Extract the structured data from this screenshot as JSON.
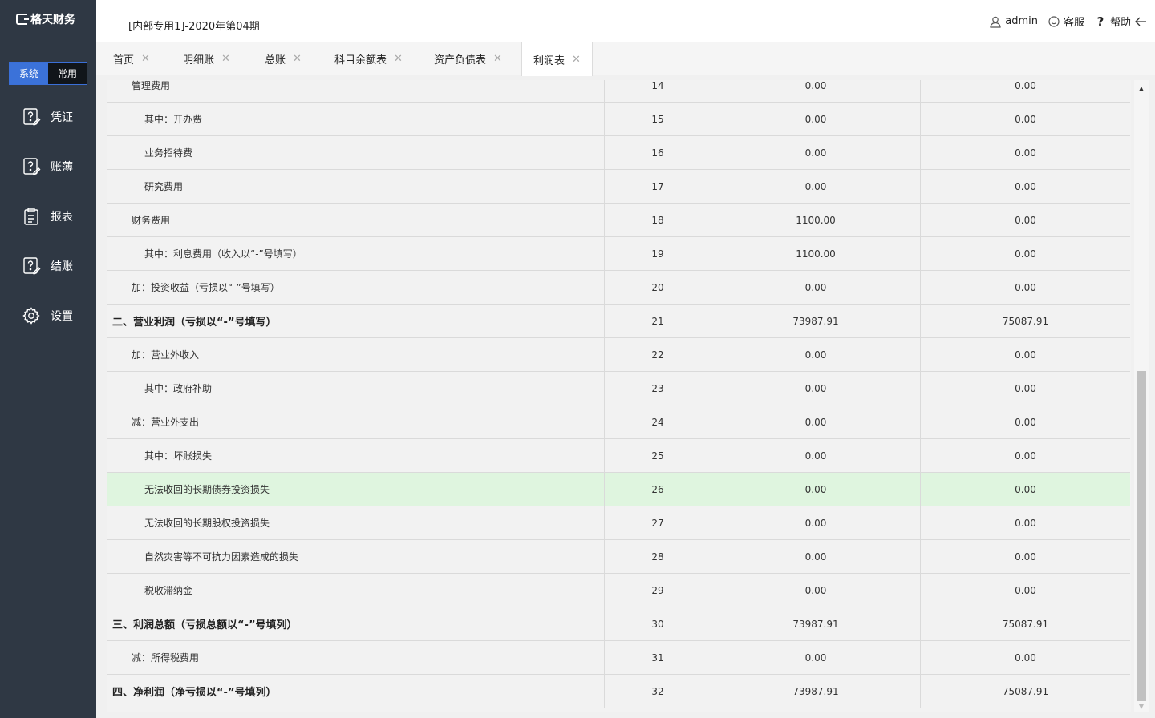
{
  "brand": "格天财务",
  "sidebar": {
    "mode_system": "系统",
    "mode_common": "常用",
    "items": [
      {
        "label": "凭证",
        "icon": "voucher-icon"
      },
      {
        "label": "账薄",
        "icon": "ledger-icon"
      },
      {
        "label": "报表",
        "icon": "report-icon"
      },
      {
        "label": "结账",
        "icon": "closing-icon"
      },
      {
        "label": "设置",
        "icon": "gear-icon"
      }
    ]
  },
  "header": {
    "period": "[内部专用1]-2020年第04期",
    "user": "admin",
    "service": "客服",
    "help": "帮助"
  },
  "tabs": [
    {
      "label": "首页",
      "active": false
    },
    {
      "label": "明细账",
      "active": false
    },
    {
      "label": "总账",
      "active": false
    },
    {
      "label": "科目余额表",
      "active": false
    },
    {
      "label": "资产负债表",
      "active": false
    },
    {
      "label": "利润表",
      "active": true
    }
  ],
  "table": {
    "rows": [
      {
        "name": "管理费用",
        "num": "14",
        "v1": "0.00",
        "v2": "0.00",
        "indent": 1
      },
      {
        "name": "其中：开办费",
        "num": "15",
        "v1": "0.00",
        "v2": "0.00",
        "indent": 2
      },
      {
        "name": "业务招待费",
        "num": "16",
        "v1": "0.00",
        "v2": "0.00",
        "indent": 2
      },
      {
        "name": "研究费用",
        "num": "17",
        "v1": "0.00",
        "v2": "0.00",
        "indent": 2
      },
      {
        "name": "财务费用",
        "num": "18",
        "v1": "1100.00",
        "v2": "0.00",
        "indent": 1
      },
      {
        "name": "其中：利息费用（收入以“-”号填写）",
        "num": "19",
        "v1": "1100.00",
        "v2": "0.00",
        "indent": 2
      },
      {
        "name": "加：投资收益（亏损以“-”号填写）",
        "num": "20",
        "v1": "0.00",
        "v2": "0.00",
        "indent": 1
      },
      {
        "name": "二、营业利润（亏损以“-”号填写）",
        "num": "21",
        "v1": "73987.91",
        "v2": "75087.91",
        "indent": 0,
        "bold": true
      },
      {
        "name": "加：营业外收入",
        "num": "22",
        "v1": "0.00",
        "v2": "0.00",
        "indent": 1
      },
      {
        "name": "其中：政府补助",
        "num": "23",
        "v1": "0.00",
        "v2": "0.00",
        "indent": 2
      },
      {
        "name": "减：营业外支出",
        "num": "24",
        "v1": "0.00",
        "v2": "0.00",
        "indent": 1
      },
      {
        "name": "其中：坏账损失",
        "num": "25",
        "v1": "0.00",
        "v2": "0.00",
        "indent": 2
      },
      {
        "name": "无法收回的长期债券投资损失",
        "num": "26",
        "v1": "0.00",
        "v2": "0.00",
        "indent": 2,
        "highlight": true
      },
      {
        "name": "无法收回的长期股权投资损失",
        "num": "27",
        "v1": "0.00",
        "v2": "0.00",
        "indent": 2
      },
      {
        "name": "自然灾害等不可抗力因素造成的损失",
        "num": "28",
        "v1": "0.00",
        "v2": "0.00",
        "indent": 2
      },
      {
        "name": "税收滞纳金",
        "num": "29",
        "v1": "0.00",
        "v2": "0.00",
        "indent": 2
      },
      {
        "name": "三、利润总额（亏损总额以“-”号填列）",
        "num": "30",
        "v1": "73987.91",
        "v2": "75087.91",
        "indent": 0,
        "bold": true
      },
      {
        "name": "减：所得税费用",
        "num": "31",
        "v1": "0.00",
        "v2": "0.00",
        "indent": 1
      },
      {
        "name": "四、净利润（净亏损以“-”号填列）",
        "num": "32",
        "v1": "73987.91",
        "v2": "75087.91",
        "indent": 0,
        "bold": true
      }
    ]
  }
}
